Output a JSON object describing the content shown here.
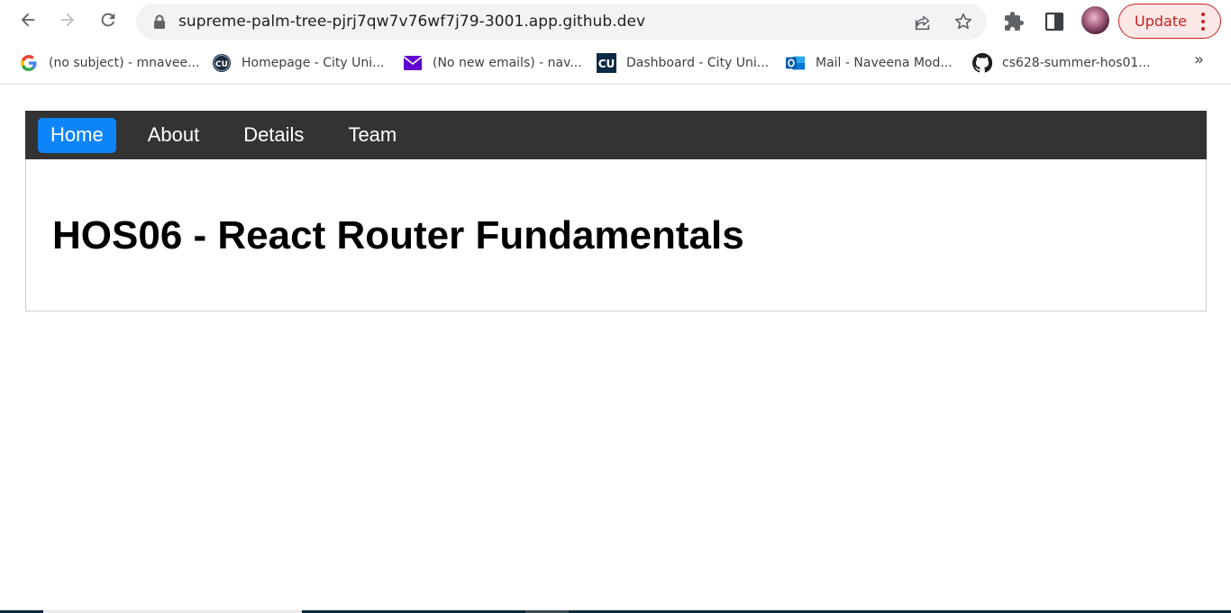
{
  "browser": {
    "url": "supreme-palm-tree-pjrj7qw7v76wf7j79-3001.app.github.dev",
    "update_label": "Update",
    "accent_color": "#c5221f"
  },
  "bookmarks": {
    "items": [
      {
        "label": "(no subject) - mnavee...",
        "icon": "google-icon"
      },
      {
        "label": "Homepage - City Uni...",
        "icon": "cityu-icon"
      },
      {
        "label": "(No new emails) - nav...",
        "icon": "mail-icon"
      },
      {
        "label": "Dashboard - City Uni...",
        "icon": "cu-icon"
      },
      {
        "label": "Mail - Naveena Mod...",
        "icon": "outlook-icon"
      },
      {
        "label": "cs628-summer-hos01...",
        "icon": "github-icon"
      }
    ],
    "overflow": "»"
  },
  "app": {
    "nav": [
      {
        "label": "Home",
        "active": true
      },
      {
        "label": "About",
        "active": false
      },
      {
        "label": "Details",
        "active": false
      },
      {
        "label": "Team",
        "active": false
      }
    ],
    "heading": "HOS06 - React Router Fundamentals",
    "colors": {
      "nav_bg": "#333333",
      "active_tab": "#0d84f8"
    }
  }
}
